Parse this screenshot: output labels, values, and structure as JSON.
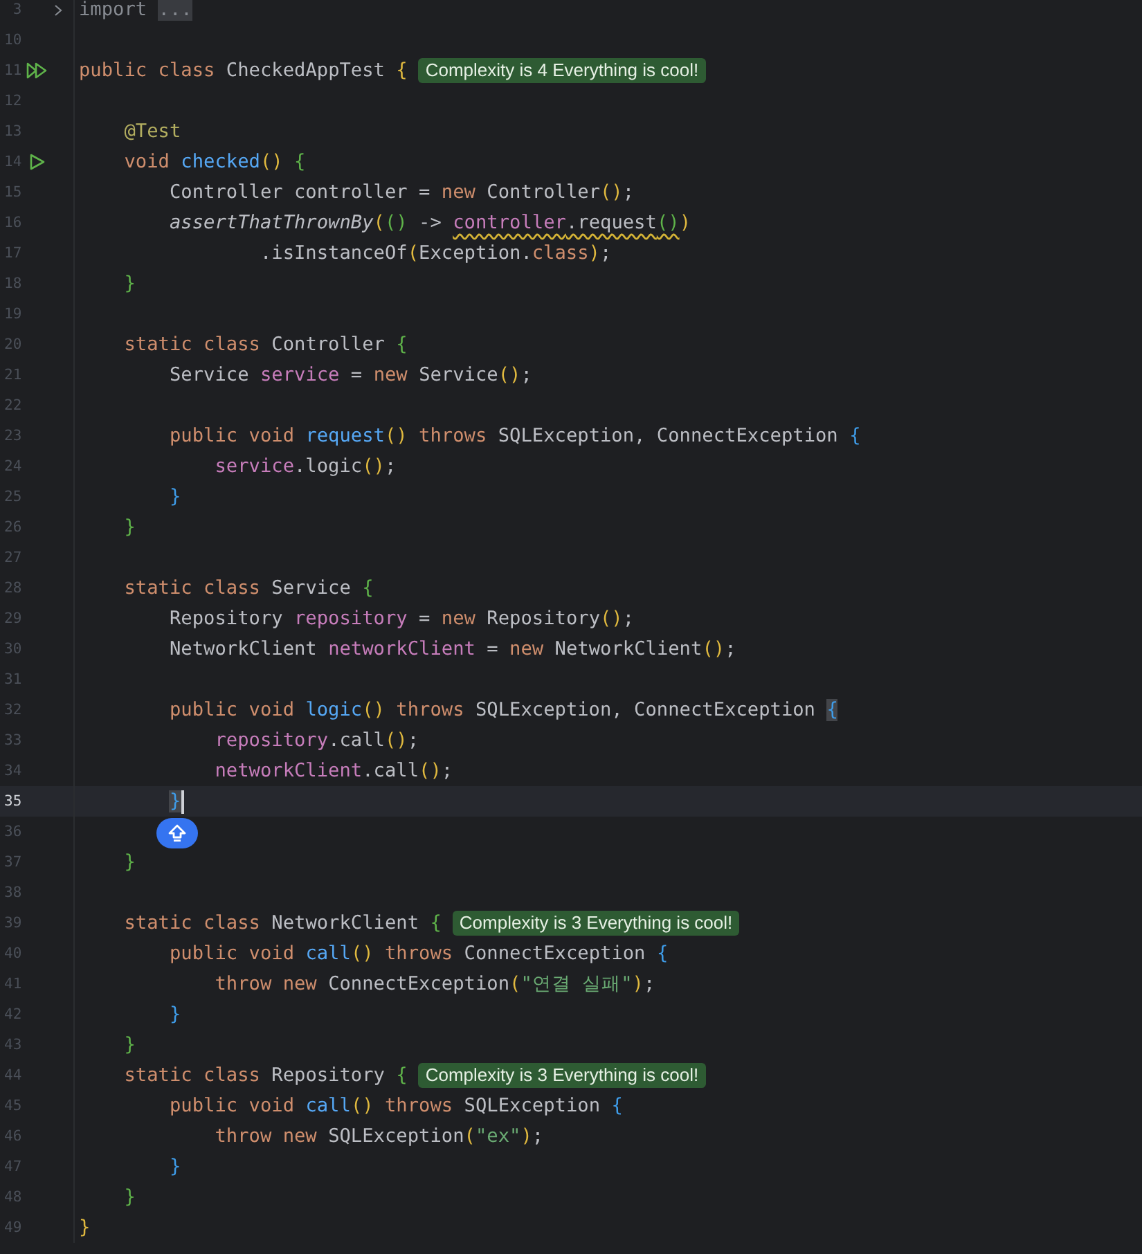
{
  "editor": {
    "lines": [
      {
        "number": "3",
        "folded": true,
        "tokens": [
          {
            "kind": "dim",
            "text": "import "
          },
          {
            "kind": "folded",
            "text": "..."
          }
        ]
      },
      {
        "number": "10"
      },
      {
        "number": "11",
        "run_all": true,
        "tokens": [
          {
            "kind": "keyword",
            "text": "public class "
          },
          {
            "kind": "plain",
            "text": "CheckedAppTest "
          },
          {
            "kind": "bracket1",
            "text": "{"
          }
        ],
        "badge": "Complexity is 4 Everything is cool!"
      },
      {
        "number": "12"
      },
      {
        "number": "13",
        "tokens": [
          {
            "kind": "annotation",
            "text": "    @Test"
          }
        ]
      },
      {
        "number": "14",
        "run": true,
        "tokens": [
          {
            "kind": "keyword",
            "text": "    void "
          },
          {
            "kind": "method",
            "text": "checked"
          },
          {
            "kind": "bracket1",
            "text": "() "
          },
          {
            "kind": "bracket2",
            "text": "{"
          }
        ]
      },
      {
        "number": "15",
        "tokens": [
          {
            "kind": "plain",
            "text": "        Controller controller = "
          },
          {
            "kind": "keyword",
            "text": "new "
          },
          {
            "kind": "plain",
            "text": "Controller"
          },
          {
            "kind": "bracket1",
            "text": "()"
          },
          {
            "kind": "plain",
            "text": ";"
          }
        ]
      },
      {
        "number": "16",
        "tokens": [
          {
            "kind": "italic",
            "text": "        assertThatThrownBy"
          },
          {
            "kind": "bracket1",
            "text": "("
          },
          {
            "kind": "bracket2",
            "text": "()"
          },
          {
            "kind": "plain",
            "text": " -> "
          },
          {
            "kind": "field",
            "text": "controller",
            "warn": true
          },
          {
            "kind": "plain",
            "text": ".request",
            "warn": true
          },
          {
            "kind": "bracket2",
            "text": "()",
            "warn": true
          },
          {
            "kind": "bracket1",
            "text": ")"
          }
        ]
      },
      {
        "number": "17",
        "tokens": [
          {
            "kind": "plain",
            "text": "                .isInstanceOf"
          },
          {
            "kind": "bracket1",
            "text": "("
          },
          {
            "kind": "plain",
            "text": "Exception."
          },
          {
            "kind": "keyword",
            "text": "class"
          },
          {
            "kind": "bracket1",
            "text": ")"
          },
          {
            "kind": "plain",
            "text": ";"
          }
        ]
      },
      {
        "number": "18",
        "tokens": [
          {
            "kind": "bracket2",
            "text": "    }"
          }
        ]
      },
      {
        "number": "19"
      },
      {
        "number": "20",
        "tokens": [
          {
            "kind": "keyword",
            "text": "    static class "
          },
          {
            "kind": "plain",
            "text": "Controller "
          },
          {
            "kind": "bracket2",
            "text": "{"
          }
        ]
      },
      {
        "number": "21",
        "tokens": [
          {
            "kind": "plain",
            "text": "        Service "
          },
          {
            "kind": "field",
            "text": "service"
          },
          {
            "kind": "plain",
            "text": " = "
          },
          {
            "kind": "keyword",
            "text": "new "
          },
          {
            "kind": "plain",
            "text": "Service"
          },
          {
            "kind": "bracket1",
            "text": "()"
          },
          {
            "kind": "plain",
            "text": ";"
          }
        ]
      },
      {
        "number": "22"
      },
      {
        "number": "23",
        "tokens": [
          {
            "kind": "keyword",
            "text": "        public void "
          },
          {
            "kind": "method",
            "text": "request"
          },
          {
            "kind": "bracket1",
            "text": "() "
          },
          {
            "kind": "keyword",
            "text": "throws "
          },
          {
            "kind": "plain",
            "text": "SQLException, ConnectException "
          },
          {
            "kind": "bracket3",
            "text": "{"
          }
        ]
      },
      {
        "number": "24",
        "tokens": [
          {
            "kind": "field",
            "text": "            service"
          },
          {
            "kind": "plain",
            "text": ".logic"
          },
          {
            "kind": "bracket1",
            "text": "()"
          },
          {
            "kind": "plain",
            "text": ";"
          }
        ]
      },
      {
        "number": "25",
        "tokens": [
          {
            "kind": "bracket3",
            "text": "        }"
          }
        ]
      },
      {
        "number": "26",
        "tokens": [
          {
            "kind": "bracket2",
            "text": "    }"
          }
        ]
      },
      {
        "number": "27"
      },
      {
        "number": "28",
        "tokens": [
          {
            "kind": "keyword",
            "text": "    static class "
          },
          {
            "kind": "plain",
            "text": "Service "
          },
          {
            "kind": "bracket2",
            "text": "{"
          }
        ]
      },
      {
        "number": "29",
        "tokens": [
          {
            "kind": "plain",
            "text": "        Repository "
          },
          {
            "kind": "field",
            "text": "repository"
          },
          {
            "kind": "plain",
            "text": " = "
          },
          {
            "kind": "keyword",
            "text": "new "
          },
          {
            "kind": "plain",
            "text": "Repository"
          },
          {
            "kind": "bracket1",
            "text": "()"
          },
          {
            "kind": "plain",
            "text": ";"
          }
        ]
      },
      {
        "number": "30",
        "tokens": [
          {
            "kind": "plain",
            "text": "        NetworkClient "
          },
          {
            "kind": "field",
            "text": "networkClient"
          },
          {
            "kind": "plain",
            "text": " = "
          },
          {
            "kind": "keyword",
            "text": "new "
          },
          {
            "kind": "plain",
            "text": "NetworkClient"
          },
          {
            "kind": "bracket1",
            "text": "()"
          },
          {
            "kind": "plain",
            "text": ";"
          }
        ]
      },
      {
        "number": "31"
      },
      {
        "number": "32",
        "tokens": [
          {
            "kind": "keyword",
            "text": "        public void "
          },
          {
            "kind": "method",
            "text": "logic"
          },
          {
            "kind": "bracket1",
            "text": "() "
          },
          {
            "kind": "keyword",
            "text": "throws "
          },
          {
            "kind": "plain",
            "text": "SQLException, ConnectException "
          },
          {
            "kind": "bracket3",
            "text": "{",
            "match": true
          }
        ]
      },
      {
        "number": "33",
        "tokens": [
          {
            "kind": "field",
            "text": "            repository"
          },
          {
            "kind": "plain",
            "text": ".call"
          },
          {
            "kind": "bracket1",
            "text": "()"
          },
          {
            "kind": "plain",
            "text": ";"
          }
        ]
      },
      {
        "number": "34",
        "tokens": [
          {
            "kind": "field",
            "text": "            networkClient"
          },
          {
            "kind": "plain",
            "text": ".call"
          },
          {
            "kind": "bracket1",
            "text": "()"
          },
          {
            "kind": "plain",
            "text": ";"
          }
        ]
      },
      {
        "number": "35",
        "current": true,
        "caret": true,
        "tokens": [
          {
            "kind": "bracket3",
            "text": "        }",
            "match": true
          }
        ]
      },
      {
        "number": "36",
        "floating_button": true
      },
      {
        "number": "37",
        "tokens": [
          {
            "kind": "bracket2",
            "text": "    }"
          }
        ]
      },
      {
        "number": "38"
      },
      {
        "number": "39",
        "tokens": [
          {
            "kind": "keyword",
            "text": "    static class "
          },
          {
            "kind": "plain",
            "text": "NetworkClient "
          },
          {
            "kind": "bracket2",
            "text": "{"
          }
        ],
        "badge": "Complexity is 3 Everything is cool!"
      },
      {
        "number": "40",
        "tokens": [
          {
            "kind": "keyword",
            "text": "        public void "
          },
          {
            "kind": "method",
            "text": "call"
          },
          {
            "kind": "bracket1",
            "text": "() "
          },
          {
            "kind": "keyword",
            "text": "throws "
          },
          {
            "kind": "plain",
            "text": "ConnectException "
          },
          {
            "kind": "bracket3",
            "text": "{"
          }
        ]
      },
      {
        "number": "41",
        "tokens": [
          {
            "kind": "keyword",
            "text": "            throw new "
          },
          {
            "kind": "plain",
            "text": "ConnectException"
          },
          {
            "kind": "bracket1",
            "text": "("
          },
          {
            "kind": "string",
            "text": "\"연결 실패\""
          },
          {
            "kind": "bracket1",
            "text": ")"
          },
          {
            "kind": "plain",
            "text": ";"
          }
        ]
      },
      {
        "number": "42",
        "tokens": [
          {
            "kind": "bracket3",
            "text": "        }"
          }
        ]
      },
      {
        "number": "43",
        "tokens": [
          {
            "kind": "bracket2",
            "text": "    }"
          }
        ]
      },
      {
        "number": "44",
        "tokens": [
          {
            "kind": "keyword",
            "text": "    static class "
          },
          {
            "kind": "plain",
            "text": "Repository "
          },
          {
            "kind": "bracket2",
            "text": "{"
          }
        ],
        "badge": "Complexity is 3 Everything is cool!"
      },
      {
        "number": "45",
        "tokens": [
          {
            "kind": "keyword",
            "text": "        public void "
          },
          {
            "kind": "method",
            "text": "call"
          },
          {
            "kind": "bracket1",
            "text": "() "
          },
          {
            "kind": "keyword",
            "text": "throws "
          },
          {
            "kind": "plain",
            "text": "SQLException "
          },
          {
            "kind": "bracket3",
            "text": "{"
          }
        ]
      },
      {
        "number": "46",
        "tokens": [
          {
            "kind": "keyword",
            "text": "            throw new "
          },
          {
            "kind": "plain",
            "text": "SQLException"
          },
          {
            "kind": "bracket1",
            "text": "("
          },
          {
            "kind": "string",
            "text": "\"ex\""
          },
          {
            "kind": "bracket1",
            "text": ")"
          },
          {
            "kind": "plain",
            "text": ";"
          }
        ]
      },
      {
        "number": "47",
        "tokens": [
          {
            "kind": "bracket3",
            "text": "        }"
          }
        ]
      },
      {
        "number": "48",
        "tokens": [
          {
            "kind": "bracket2",
            "text": "    }"
          }
        ]
      },
      {
        "number": "49",
        "tokens": [
          {
            "kind": "bracket1",
            "text": "}"
          }
        ]
      }
    ]
  }
}
